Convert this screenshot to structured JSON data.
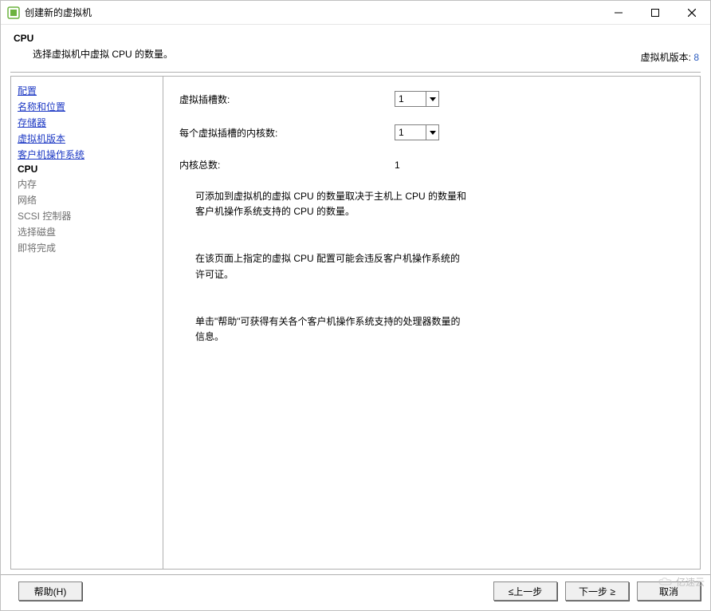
{
  "titlebar": {
    "title": "创建新的虚拟机"
  },
  "header": {
    "title": "CPU",
    "subtitle": "选择虚拟机中虚拟 CPU 的数量。",
    "version_label": "虚拟机版本:",
    "version_value": "8"
  },
  "sidebar": {
    "items": [
      {
        "label": "配置",
        "state": "link"
      },
      {
        "label": "名称和位置",
        "state": "link"
      },
      {
        "label": "存储器",
        "state": "link"
      },
      {
        "label": "虚拟机版本",
        "state": "link"
      },
      {
        "label": "客户机操作系统",
        "state": "link"
      },
      {
        "label": "CPU",
        "state": "current"
      },
      {
        "label": "内存",
        "state": "pending"
      },
      {
        "label": "网络",
        "state": "pending"
      },
      {
        "label": "SCSI 控制器",
        "state": "pending"
      },
      {
        "label": "选择磁盘",
        "state": "pending"
      },
      {
        "label": "即将完成",
        "state": "pending"
      }
    ]
  },
  "form": {
    "sockets_label": "虚拟插槽数:",
    "sockets_value": "1",
    "cores_label": "每个虚拟插槽的内核数:",
    "cores_value": "1",
    "total_label": "内核总数:",
    "total_value": "1",
    "note1": "可添加到虚拟机的虚拟 CPU 的数量取决于主机上 CPU 的数量和客户机操作系统支持的 CPU 的数量。",
    "note2": "在该页面上指定的虚拟 CPU 配置可能会违反客户机操作系统的许可证。",
    "note3": "单击\"帮助\"可获得有关各个客户机操作系统支持的处理器数量的信息。"
  },
  "footer": {
    "help": "帮助(H)",
    "back": "≤上一步",
    "next": "下一步 ≥",
    "cancel": "取消"
  },
  "watermark": "亿速云"
}
